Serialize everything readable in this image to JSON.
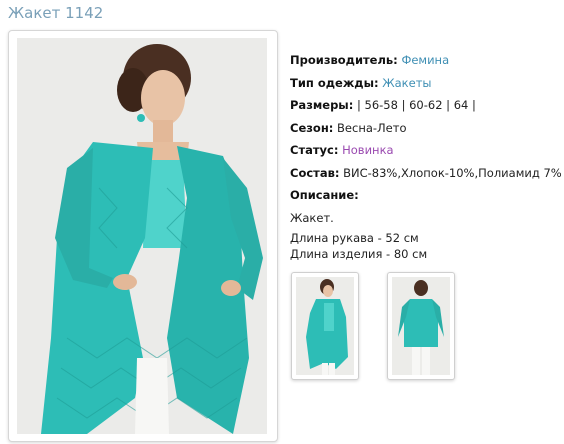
{
  "page": {
    "title": "Жакет 1142"
  },
  "product": {
    "manufacturer": {
      "label": "Производитель:",
      "value": "Фемина"
    },
    "garment_type": {
      "label": "Тип одежды:",
      "value": "Жакеты"
    },
    "sizes": {
      "label": "Размеры:",
      "value": " | 56-58 | 60-62 | 64 |"
    },
    "season": {
      "label": "Сезон:",
      "value": " Весна-Лето"
    },
    "status": {
      "label": "Статус:",
      "value": "Новинка"
    },
    "composition": {
      "label": "Состав:",
      "value": " ВИС-83%,Хлопок-10%,Полиамид 7%"
    },
    "description": {
      "label": "Описание:",
      "lines": [
        "Жакет.",
        "Длина рукава - 52 см",
        "Длина изделия - 80 см"
      ]
    }
  },
  "colors": {
    "garment": "#2dbdb6",
    "link": "#3f8fb4",
    "status": "#9a4ab0",
    "title": "#7aa0b8"
  }
}
